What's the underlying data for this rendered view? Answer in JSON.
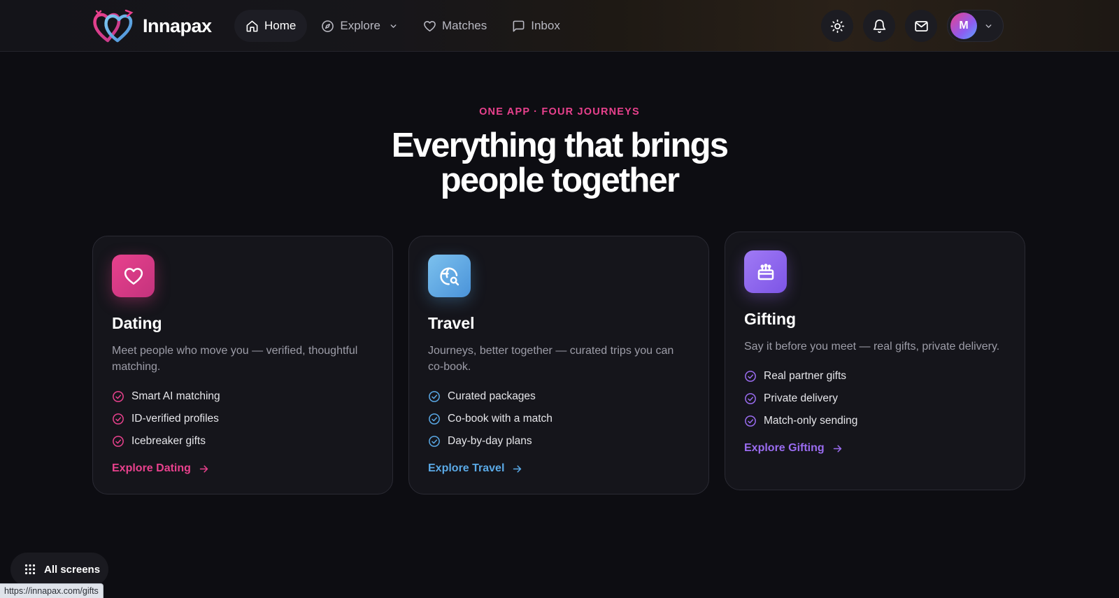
{
  "brand": {
    "name": "Innapax",
    "logo_icon": "intertwined-hearts-icon"
  },
  "nav": {
    "items": [
      {
        "label": "Home",
        "icon": "home-icon",
        "active": true
      },
      {
        "label": "Explore",
        "icon": "compass-icon",
        "has_dropdown": true
      },
      {
        "label": "Matches",
        "icon": "heart-icon"
      },
      {
        "label": "Inbox",
        "icon": "message-square-icon"
      }
    ]
  },
  "actions": {
    "icons": [
      "sun-icon",
      "bell-icon",
      "mail-icon"
    ],
    "avatar_initial": "M"
  },
  "hero": {
    "eyebrow": "ONE APP · FOUR JOURNEYS",
    "headline_line1": "Everything that brings",
    "headline_line2": "people together"
  },
  "cards": [
    {
      "title": "Dating",
      "description": "Meet people who move you — verified, thoughtful matching.",
      "features": [
        "Smart AI matching",
        "ID-verified profiles",
        "Icebreaker gifts"
      ],
      "link": "Explore Dating",
      "icon": "heart-icon",
      "accent": "#e8418d"
    },
    {
      "title": "Travel",
      "description": "Journeys, better together — curated trips you can co-book.",
      "features": [
        "Curated packages",
        "Co-book with a match",
        "Day-by-day plans"
      ],
      "link": "Explore Travel",
      "icon": "globe-search-icon",
      "accent": "#5aa9e6"
    },
    {
      "title": "Gifting",
      "description": "Say it before you meet — real gifts, private delivery.",
      "features": [
        "Real partner gifts",
        "Private delivery",
        "Match-only sending"
      ],
      "link": "Explore Gifting",
      "icon": "gift-icon",
      "accent": "#9a6cf0"
    }
  ],
  "footer": {
    "all_screens_label": "All screens",
    "all_screens_icon": "grid-dots-icon",
    "status_url": "https://innapax.com/gifts"
  },
  "colors": {
    "background": "#0d0d12",
    "card_background": "#15151b",
    "dating_accent": "#e8418d",
    "travel_accent": "#5aa9e6",
    "gifting_accent": "#9a6cf0"
  }
}
